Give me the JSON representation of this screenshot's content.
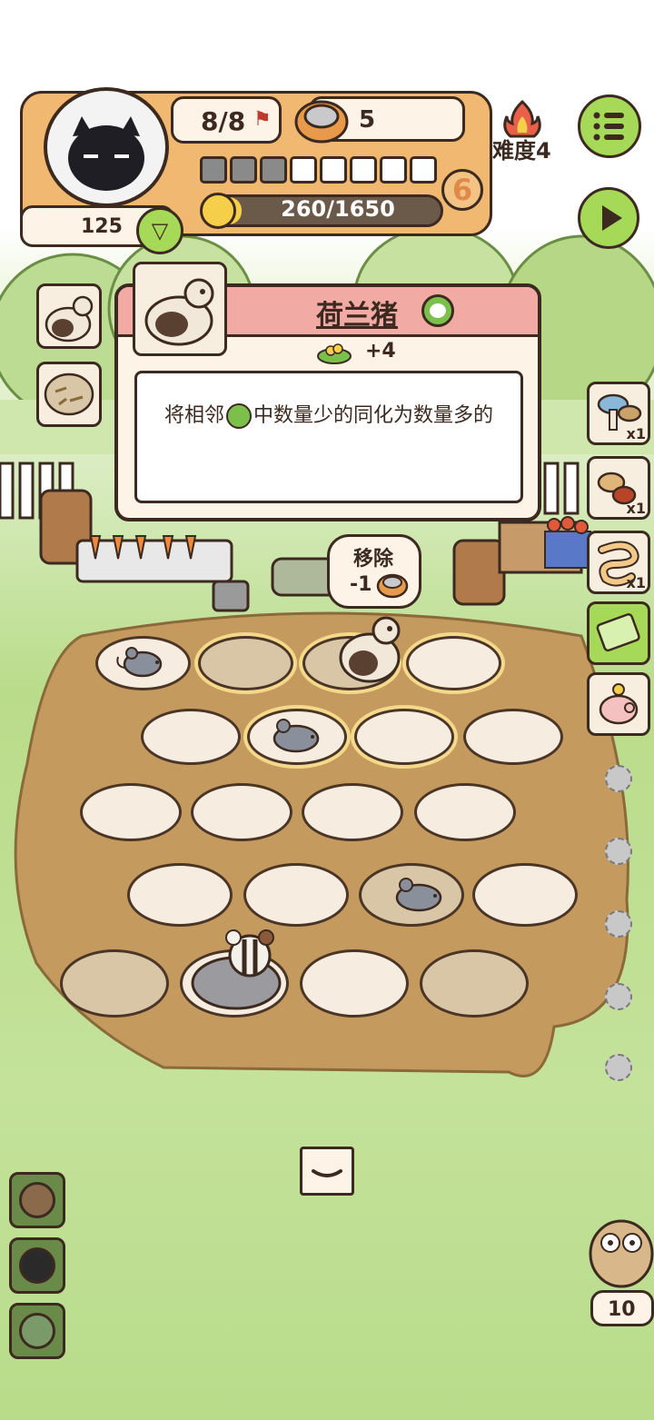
{
  "hud": {
    "level_progress": "8/8",
    "food_count": "5",
    "difficulty_label": "难度4",
    "coin_count": "125",
    "xp_text": "260/1650",
    "xp_fraction": 0.158,
    "level_number": "6",
    "segments_total": 8,
    "segments_filled": 3
  },
  "tooltip": {
    "title": "荷兰猪",
    "bonus": "+4",
    "description_before_icon": "将相邻",
    "description_after_icon": "中数量少的同化为数量多的"
  },
  "remove_bubble": {
    "label": "移除",
    "cost": "-1"
  },
  "side_items": [
    {
      "name": "mushroom",
      "count": "x1"
    },
    {
      "name": "peanut",
      "count": "x1"
    },
    {
      "name": "worm",
      "count": "x1"
    },
    {
      "name": "ticket",
      "count": ""
    },
    {
      "name": "piggy-bank",
      "count": ""
    }
  ],
  "owl_counter": "10",
  "colors": {
    "accent_orange": "#f0b870",
    "button_green": "#a6d957",
    "title_bar_pink": "#f2aaa5",
    "ground": "#c49a5e",
    "outline": "#3c2a20"
  }
}
